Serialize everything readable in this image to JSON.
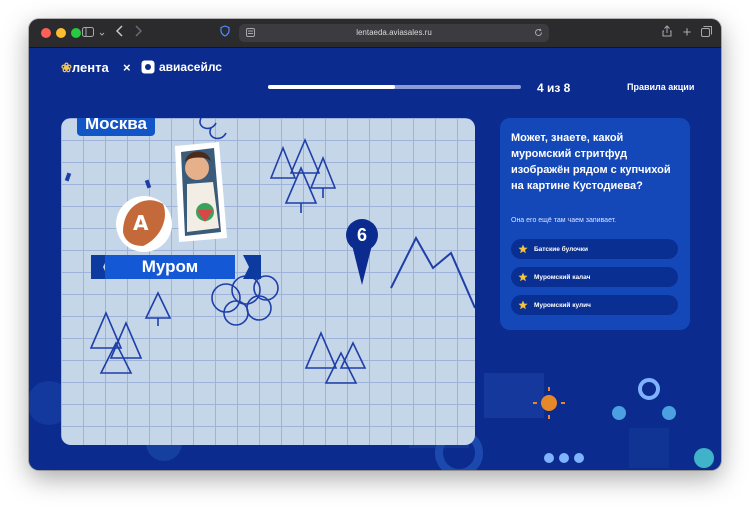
{
  "browser": {
    "url": "lentaeda.aviasales.ru"
  },
  "header": {
    "logo_lenta": "лента",
    "separator": "×",
    "logo_aviasales": "авиасейлс",
    "progress_fraction": 0.5,
    "counter": "4 из 8",
    "rules_link": "Правила акции"
  },
  "map": {
    "city_top": "Москва",
    "city_current": "Муром",
    "marker_number": "6"
  },
  "quiz": {
    "question": "Может, знаете, какой муромский стритфуд изображён рядом с купчихой на картине Кустодиева?",
    "hint": "Она его ещё там чаем запивает.",
    "options": [
      {
        "label": "Батские булочки"
      },
      {
        "label": "Муромский калач"
      },
      {
        "label": "Муромский кулич"
      }
    ]
  },
  "colors": {
    "page_bg": "#0b2c8e",
    "panel_bg": "#1448b8",
    "option_bg": "#0a2f92",
    "star": "#f5c23a",
    "lenta_green": "#f6c54a"
  }
}
